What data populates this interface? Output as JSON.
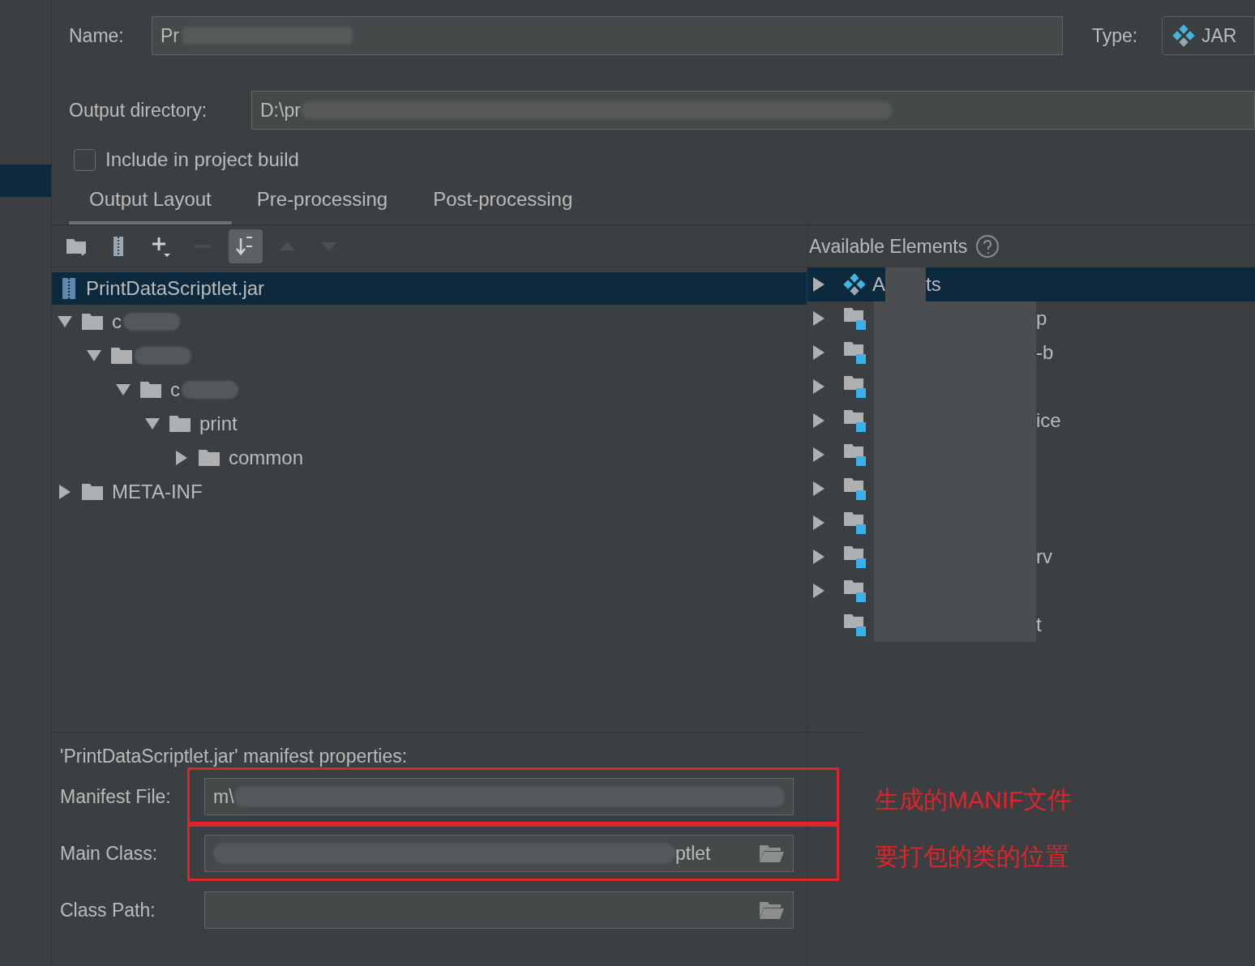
{
  "name_field": {
    "label": "Name:",
    "value": "Pr"
  },
  "type_field": {
    "label": "Type:",
    "value": "JAR"
  },
  "output_directory": {
    "label": "Output directory:",
    "value": "D:\\pr"
  },
  "include_in_build": {
    "label": "Include in project build",
    "checked": false
  },
  "tabs": [
    {
      "label": "Output Layout",
      "selected": true
    },
    {
      "label": "Pre-processing",
      "selected": false
    },
    {
      "label": "Post-processing",
      "selected": false
    }
  ],
  "toolbar": [
    {
      "kind": "new-folder",
      "disabled": false
    },
    {
      "kind": "archive",
      "disabled": false
    },
    {
      "kind": "add",
      "disabled": false
    },
    {
      "kind": "remove",
      "disabled": true
    },
    {
      "kind": "sort",
      "disabled": false,
      "selected": true
    },
    {
      "kind": "up",
      "disabled": true
    },
    {
      "kind": "down",
      "disabled": true
    }
  ],
  "output_tree": {
    "root": {
      "label": "PrintDataScriptlet.jar",
      "selected": true
    },
    "children": [
      {
        "label": "c",
        "redacted": true,
        "expanded": true,
        "children": [
          {
            "redacted": true,
            "expanded": true,
            "children": [
              {
                "label": "c",
                "redacted": true,
                "expanded": true,
                "children": [
                  {
                    "label": "print",
                    "expanded": true,
                    "children": [
                      {
                        "label": "common",
                        "expanded": false
                      }
                    ]
                  }
                ]
              }
            ]
          }
        ]
      },
      {
        "label": "META-INF",
        "expanded": false
      }
    ]
  },
  "available_elements": {
    "title": "Available Elements",
    "items": [
      {
        "kind": "artifact",
        "label_start": "A",
        "label_end": "ts",
        "selected": true,
        "expandable": true
      },
      {
        "kind": "module",
        "label_end": "p",
        "selected": false,
        "expandable": true
      },
      {
        "kind": "module",
        "label_end": "-b",
        "selected": false,
        "expandable": true
      },
      {
        "kind": "module",
        "selected": false,
        "expandable": true
      },
      {
        "kind": "module",
        "label_end": "ice",
        "selected": false,
        "expandable": true
      },
      {
        "kind": "module",
        "selected": false,
        "expandable": true
      },
      {
        "kind": "module",
        "selected": false,
        "expandable": true
      },
      {
        "kind": "module",
        "selected": false,
        "expandable": true
      },
      {
        "kind": "module",
        "label_end": "rv",
        "selected": false,
        "expandable": true
      },
      {
        "kind": "module",
        "selected": false,
        "expandable": true
      },
      {
        "kind": "module",
        "label_end": "t",
        "selected": false,
        "expandable": false
      }
    ]
  },
  "manifest": {
    "title": "'PrintDataScriptlet.jar' manifest properties:",
    "fields": [
      {
        "label": "Manifest File:",
        "value_start": "m\\",
        "redacted": true,
        "annotation": "生成的MANIF文件"
      },
      {
        "label": "Main Class:",
        "value_end": "ptlet",
        "redacted": true,
        "browse": true,
        "annotation": "要打包的类的位置"
      },
      {
        "label": "Class Path:",
        "browse": true
      }
    ]
  }
}
